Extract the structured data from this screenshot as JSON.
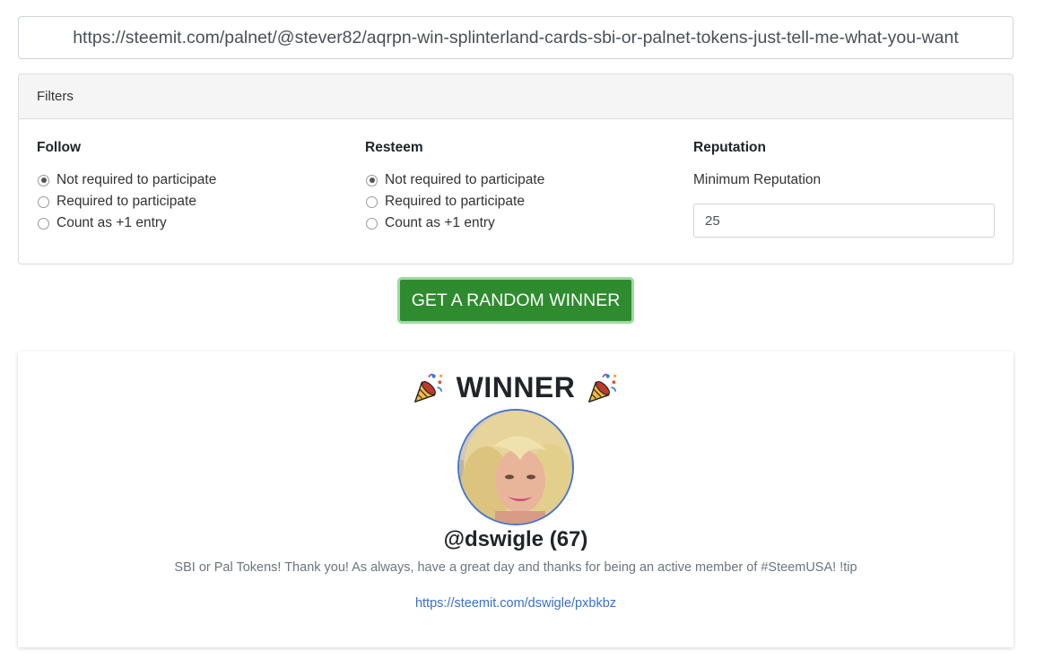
{
  "url_input": {
    "value": "https://steemit.com/palnet/@stever82/aqrpn-win-splinterland-cards-sbi-or-palnet-tokens-just-tell-me-what-you-want"
  },
  "filters": {
    "header": "Filters",
    "follow": {
      "title": "Follow",
      "options": [
        "Not required to participate",
        "Required to participate",
        "Count as +1 entry"
      ],
      "selected_index": 0
    },
    "resteem": {
      "title": "Resteem",
      "options": [
        "Not required to participate",
        "Required to participate",
        "Count as +1 entry"
      ],
      "selected_index": 0
    },
    "reputation": {
      "title": "Reputation",
      "label": "Minimum Reputation",
      "value": "25"
    }
  },
  "action_button": {
    "label": "GET A RANDOM WINNER",
    "color": "#2e8b2e"
  },
  "winner": {
    "title": "WINNER",
    "icon": "party-popper-icon",
    "username": "@dswigle (67)",
    "comment": "SBI or Pal Tokens! Thank you! As always, have a great day and thanks for being an active member of #SteemUSA! !tip",
    "link": "https://steemit.com/dswigle/pxbkbz",
    "link_color": "#3a70c9"
  }
}
